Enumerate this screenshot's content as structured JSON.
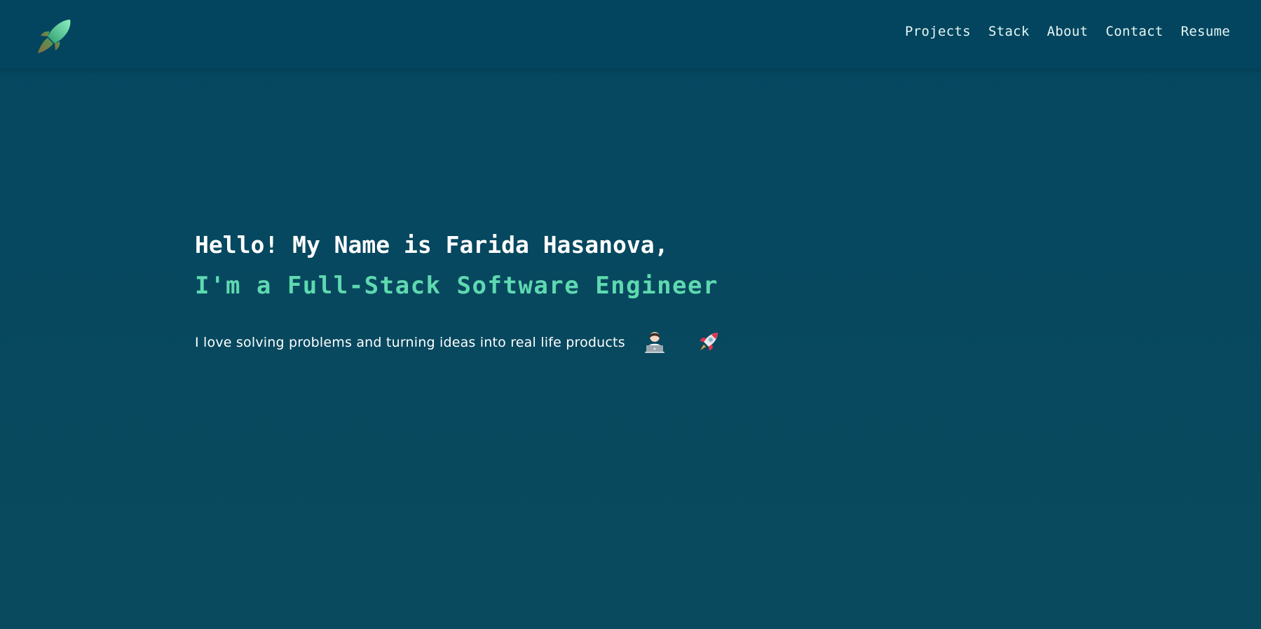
{
  "nav": {
    "logo_icon": "rocket-logo-icon",
    "links": [
      "Projects",
      "Stack",
      "About",
      "Contact",
      "Resume"
    ]
  },
  "hero": {
    "greeting": "Hello! My Name is Farida Hasanova,",
    "role": "I'm a Full-Stack Software Engineer",
    "tagline": "I love solving problems and turning ideas into real life products",
    "emojis": [
      "woman-technologist-icon",
      "rocket-icon"
    ]
  },
  "colors": {
    "background": "#044760",
    "navbar": "#03455f",
    "accent": "#5fd9b0",
    "text": "#ffffff"
  }
}
